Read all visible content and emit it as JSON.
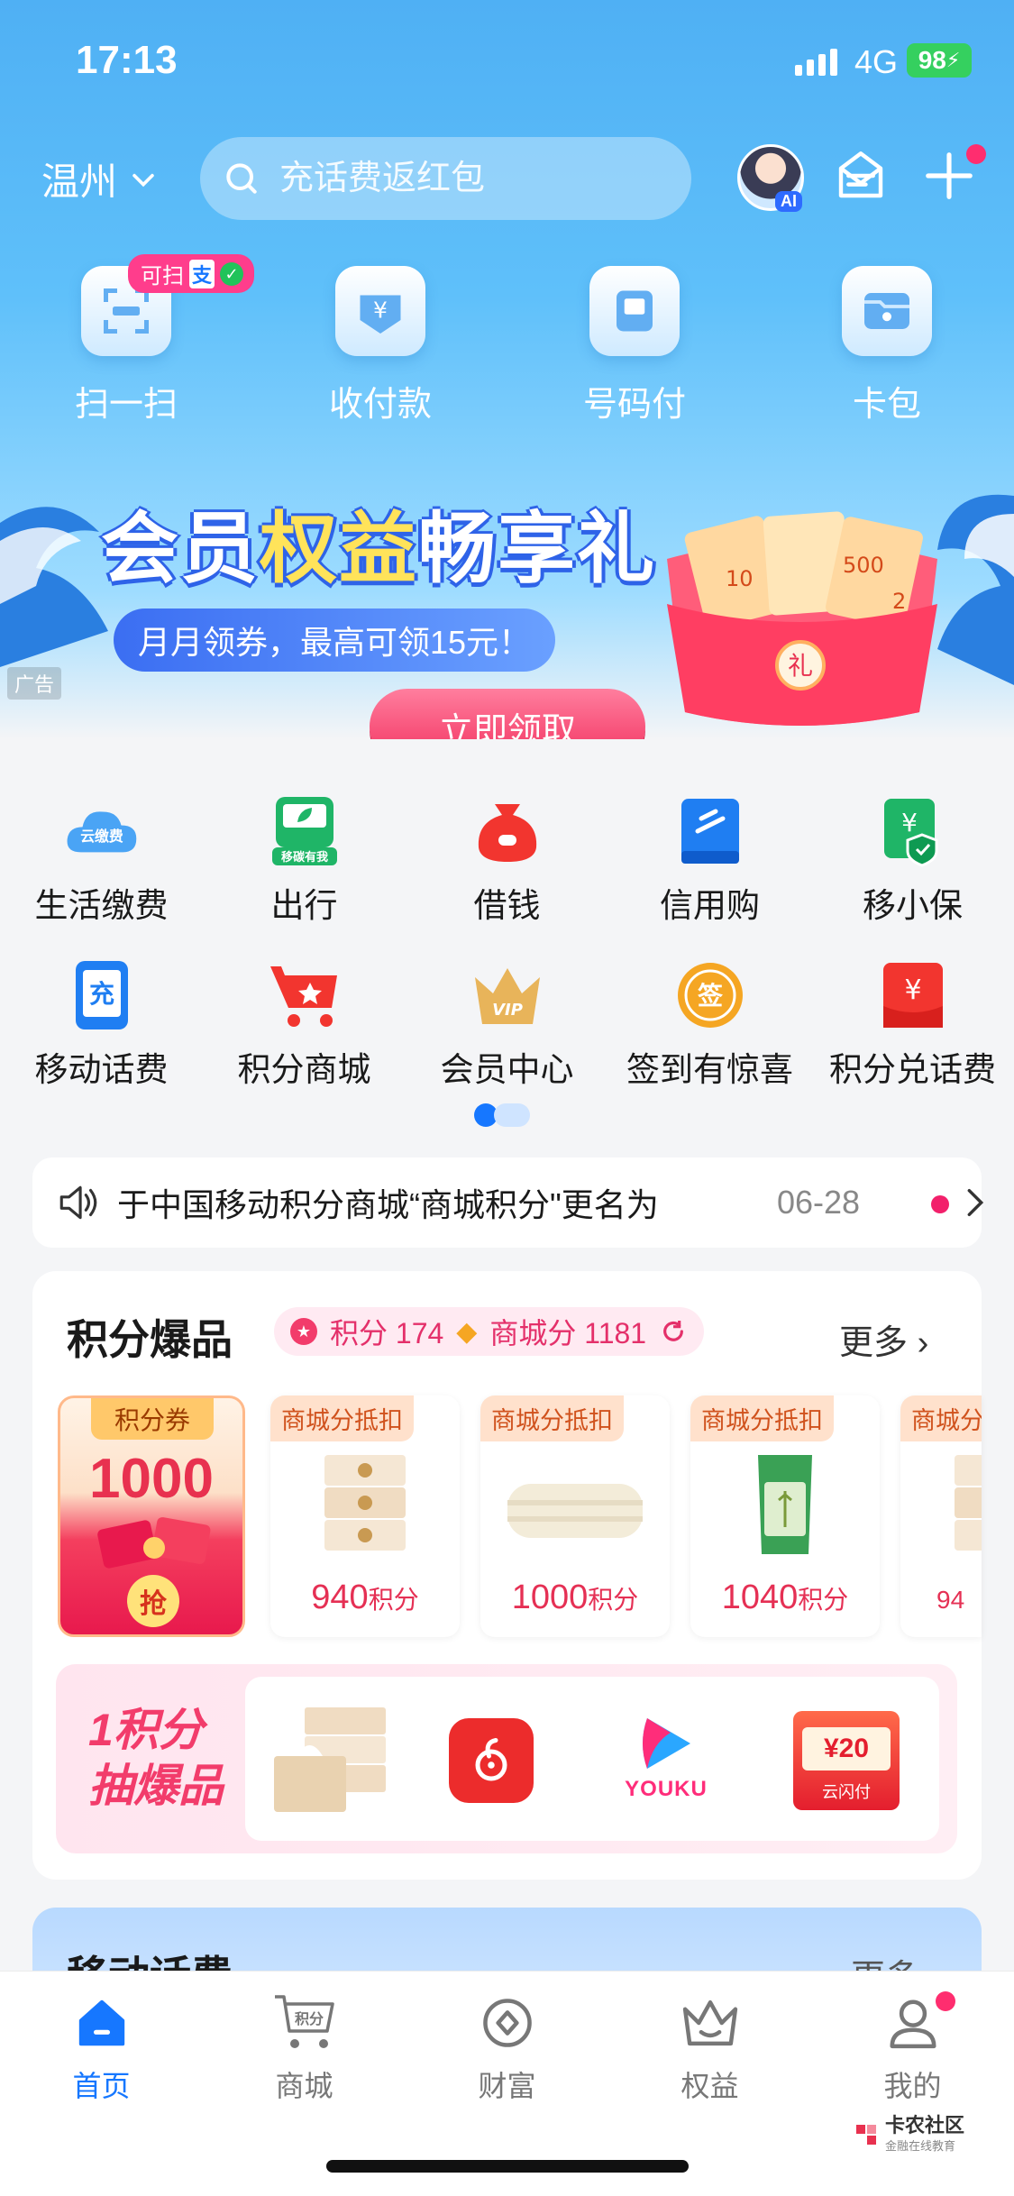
{
  "status": {
    "time": "17:13",
    "network": "4G",
    "battery": "98"
  },
  "header": {
    "city": "温州",
    "search_placeholder": "充话费返红包",
    "ai_label": "AI"
  },
  "quick_actions": [
    {
      "label": "扫一扫",
      "badge": "可扫"
    },
    {
      "label": "收付款"
    },
    {
      "label": "号码付"
    },
    {
      "label": "卡包"
    }
  ],
  "scan_badge_pay": "支",
  "banner": {
    "title_a": "会员",
    "title_b": "权益",
    "title_c": "畅享礼",
    "subtitle": "月月领券，最高可领15元！",
    "button": "立即领取",
    "ad_label": "广告",
    "gift_char": "礼",
    "gift_amounts": [
      "10",
      "500",
      "2"
    ]
  },
  "services": [
    {
      "label": "生活缴费",
      "icon": "cloud-bill-icon",
      "icon_text": "云缴费"
    },
    {
      "label": "出行",
      "icon": "eco-travel-icon",
      "icon_text": "移碳有我"
    },
    {
      "label": "借钱",
      "icon": "money-bag-icon"
    },
    {
      "label": "信用购",
      "icon": "credit-card-icon"
    },
    {
      "label": "移小保",
      "icon": "insurance-icon"
    },
    {
      "label": "移动话费",
      "icon": "phone-recharge-icon",
      "icon_text": "充"
    },
    {
      "label": "积分商城",
      "icon": "cart-icon"
    },
    {
      "label": "会员中心",
      "icon": "vip-crown-icon",
      "icon_text": "VIP"
    },
    {
      "label": "签到有惊喜",
      "icon": "checkin-icon",
      "icon_text": "签"
    },
    {
      "label": "积分兑话费",
      "icon": "points-exchange-icon"
    }
  ],
  "notice": {
    "text": "于中国移动积分商城“商城积分\"更名为“",
    "date": "06-28"
  },
  "points_section": {
    "title": "积分爆品",
    "points_label": "积分 174",
    "mall_points_label": "商城分 1181",
    "more": "更多",
    "coupon": {
      "title": "积分券",
      "value": "1000",
      "grab": "抢"
    },
    "products": [
      {
        "tag": "商城分抵扣",
        "price": "940",
        "unit": "积分",
        "name": "tissue-pack"
      },
      {
        "tag": "商城分抵扣",
        "price": "1000",
        "unit": "积分",
        "name": "towel"
      },
      {
        "tag": "商城分抵扣",
        "price": "1040",
        "unit": "积分",
        "name": "rice-bag"
      },
      {
        "tag": "商城分",
        "price": "94",
        "unit": "",
        "name": "tissue-pack-partial"
      }
    ],
    "draw": {
      "line1": "1积分",
      "line2": "抽爆品",
      "youku": "YOUKU",
      "voucher": "¥20",
      "voucher_brand": "云闪付"
    }
  },
  "next_section": {
    "title": "移动话费",
    "more": "更多"
  },
  "tabs": [
    {
      "label": "首页",
      "active": true
    },
    {
      "label": "商城",
      "icon_text": "积分"
    },
    {
      "label": "财富"
    },
    {
      "label": "权益"
    },
    {
      "label": "我的"
    }
  ],
  "watermark": {
    "title": "卡农社区",
    "subtitle": "金融在线教育"
  },
  "colors": {
    "brand_blue": "#1677ff",
    "accent_pink": "#f23c6b",
    "price_red": "#e53054"
  }
}
